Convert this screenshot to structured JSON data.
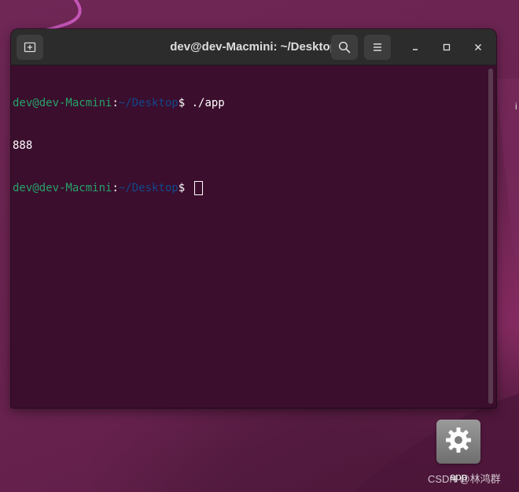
{
  "window": {
    "title": "dev@dev-Macmini: ~/Desktop",
    "new_tab_icon": "new-tab-icon",
    "search_icon": "search-icon",
    "menu_icon": "hamburger-menu-icon",
    "minimize_icon": "minimize-icon",
    "maximize_icon": "maximize-icon",
    "close_icon": "close-icon"
  },
  "terminal": {
    "lines": [
      {
        "user": "dev@dev-Macmini",
        "sep": ":",
        "path": "~/Desktop",
        "prompt": "$ ",
        "command": "./app"
      },
      {
        "output": "888"
      },
      {
        "user": "dev@dev-Macmini",
        "sep": ":",
        "path": "~/Desktop",
        "prompt": "$ ",
        "command": ""
      }
    ]
  },
  "desktop": {
    "icon_name": "gear-icon",
    "icon_label": "app",
    "edge_text": "i"
  },
  "watermark": "CSDN @林鸿群",
  "colors": {
    "terminal_bg": "#3b0e2d",
    "titlebar_bg": "#2c2c2c",
    "prompt_user": "#26a269",
    "prompt_path": "#12488b",
    "desktop_bg": "#6b2451"
  }
}
